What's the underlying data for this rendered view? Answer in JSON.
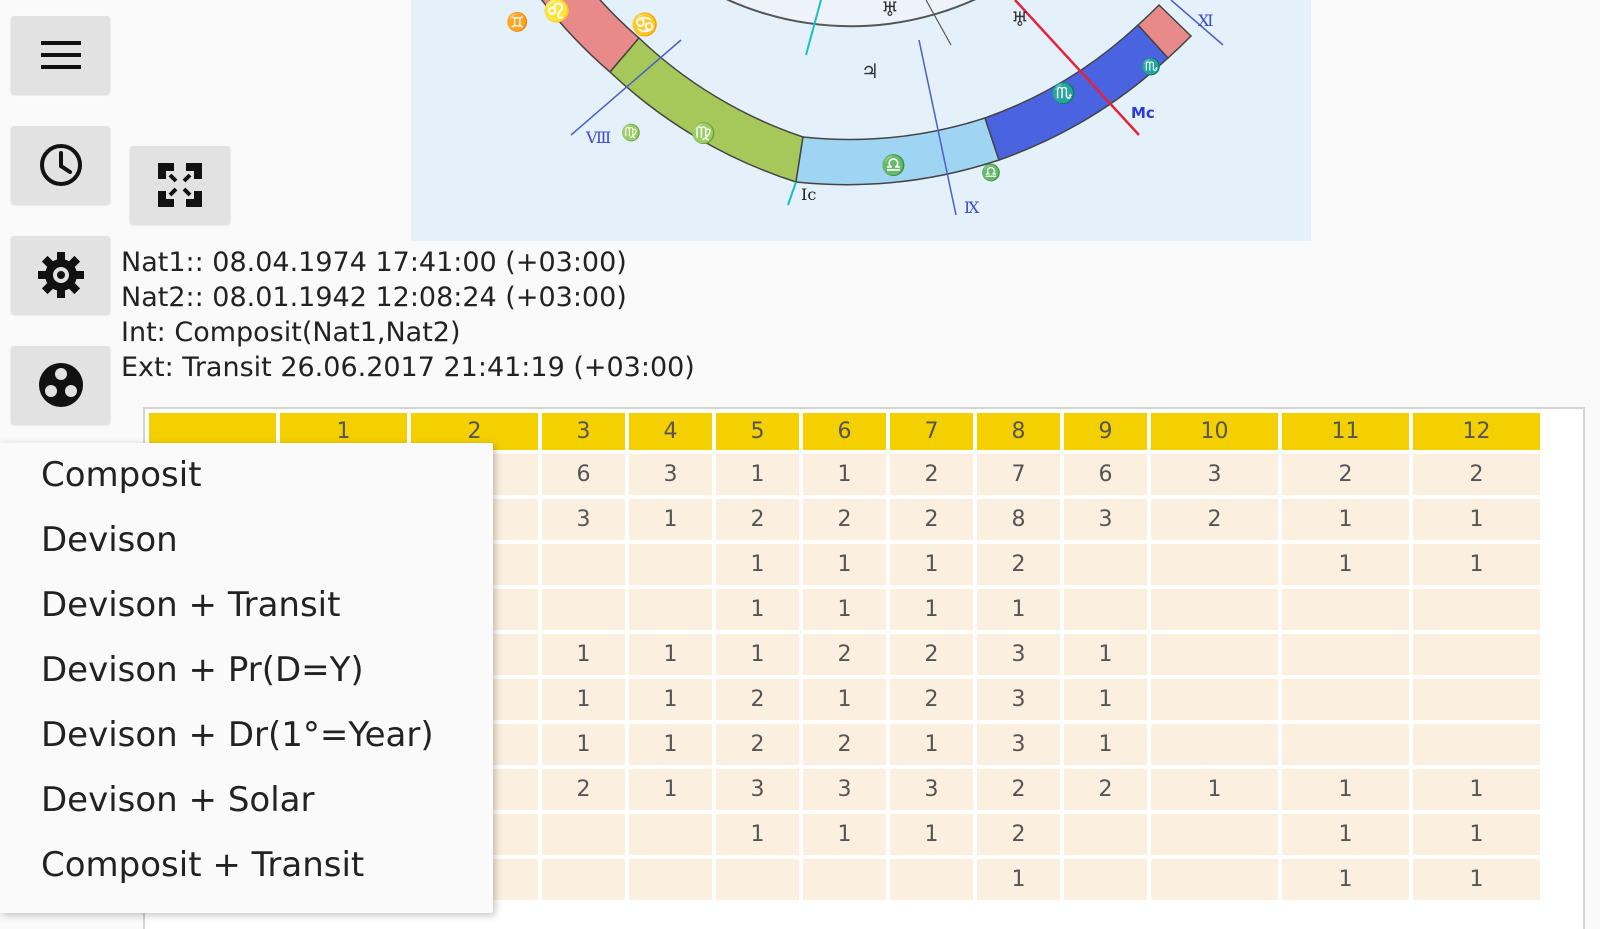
{
  "sidebar": {
    "buttons": [
      {
        "name": "menu-button",
        "icon": "hamburger-icon"
      },
      {
        "name": "time-button",
        "icon": "clock-icon"
      },
      {
        "name": "settings-button",
        "icon": "gear-icon"
      },
      {
        "name": "mode-button",
        "icon": "film-reel-icon"
      }
    ],
    "fullscreen_icon": "fullscreen-icon"
  },
  "info": {
    "nat1": "Nat1:: 08.04.1974 17:41:00 (+03:00)",
    "nat2": "Nat2:: 08.01.1942 12:08:24 (+03:00)",
    "int": "Int: Composit(Nat1,Nat2)",
    "ext": "Ext: Transit 26.06.2017 21:41:19 (+03:00)"
  },
  "table": {
    "headers": [
      "",
      "1",
      "2",
      "3",
      "4",
      "5",
      "6",
      "7",
      "8",
      "9",
      "10",
      "11",
      "12"
    ],
    "rows": [
      [
        "",
        "",
        "",
        "6",
        "3",
        "1",
        "1",
        "2",
        "7",
        "6",
        "3",
        "2",
        "2"
      ],
      [
        "",
        "",
        "",
        "3",
        "1",
        "2",
        "2",
        "2",
        "8",
        "3",
        "2",
        "1",
        "1"
      ],
      [
        "",
        "",
        "",
        "",
        "",
        "1",
        "1",
        "1",
        "2",
        "",
        "",
        "1",
        "1"
      ],
      [
        "",
        "",
        "",
        "",
        "",
        "1",
        "1",
        "1",
        "1",
        "",
        "",
        "",
        ""
      ],
      [
        "",
        "",
        "",
        "1",
        "1",
        "1",
        "2",
        "2",
        "3",
        "1",
        "",
        "",
        ""
      ],
      [
        "",
        "",
        "",
        "1",
        "1",
        "2",
        "1",
        "2",
        "3",
        "1",
        "",
        "",
        ""
      ],
      [
        "",
        "",
        "",
        "1",
        "1",
        "2",
        "2",
        "1",
        "3",
        "1",
        "",
        "",
        ""
      ],
      [
        "",
        "",
        "",
        "2",
        "1",
        "3",
        "3",
        "3",
        "2",
        "2",
        "1",
        "1",
        "1"
      ],
      [
        "",
        "",
        "",
        "",
        "",
        "1",
        "1",
        "1",
        "2",
        "",
        "",
        "1",
        "1"
      ],
      [
        "",
        "",
        "",
        "",
        "",
        "",
        "",
        "",
        "1",
        "",
        "",
        "1",
        "1"
      ]
    ]
  },
  "menu": {
    "items": [
      "Composit",
      "Devison",
      "Devison + Transit",
      "Devison + Pr(D=Y)",
      "Devison + Dr(1°=Year)",
      "Devison + Solar",
      "Composit + Transit"
    ]
  },
  "chart": {
    "labels": {
      "ic": "Ic",
      "mc": "Mc"
    },
    "colors": {
      "red_band": "#e98a8a",
      "green_band": "#a6c85a",
      "light_blue_band": "#9fd4f2",
      "blue_band": "#4a63e0",
      "background": "#e4f1fb",
      "axis_red": "#e8203a"
    }
  }
}
